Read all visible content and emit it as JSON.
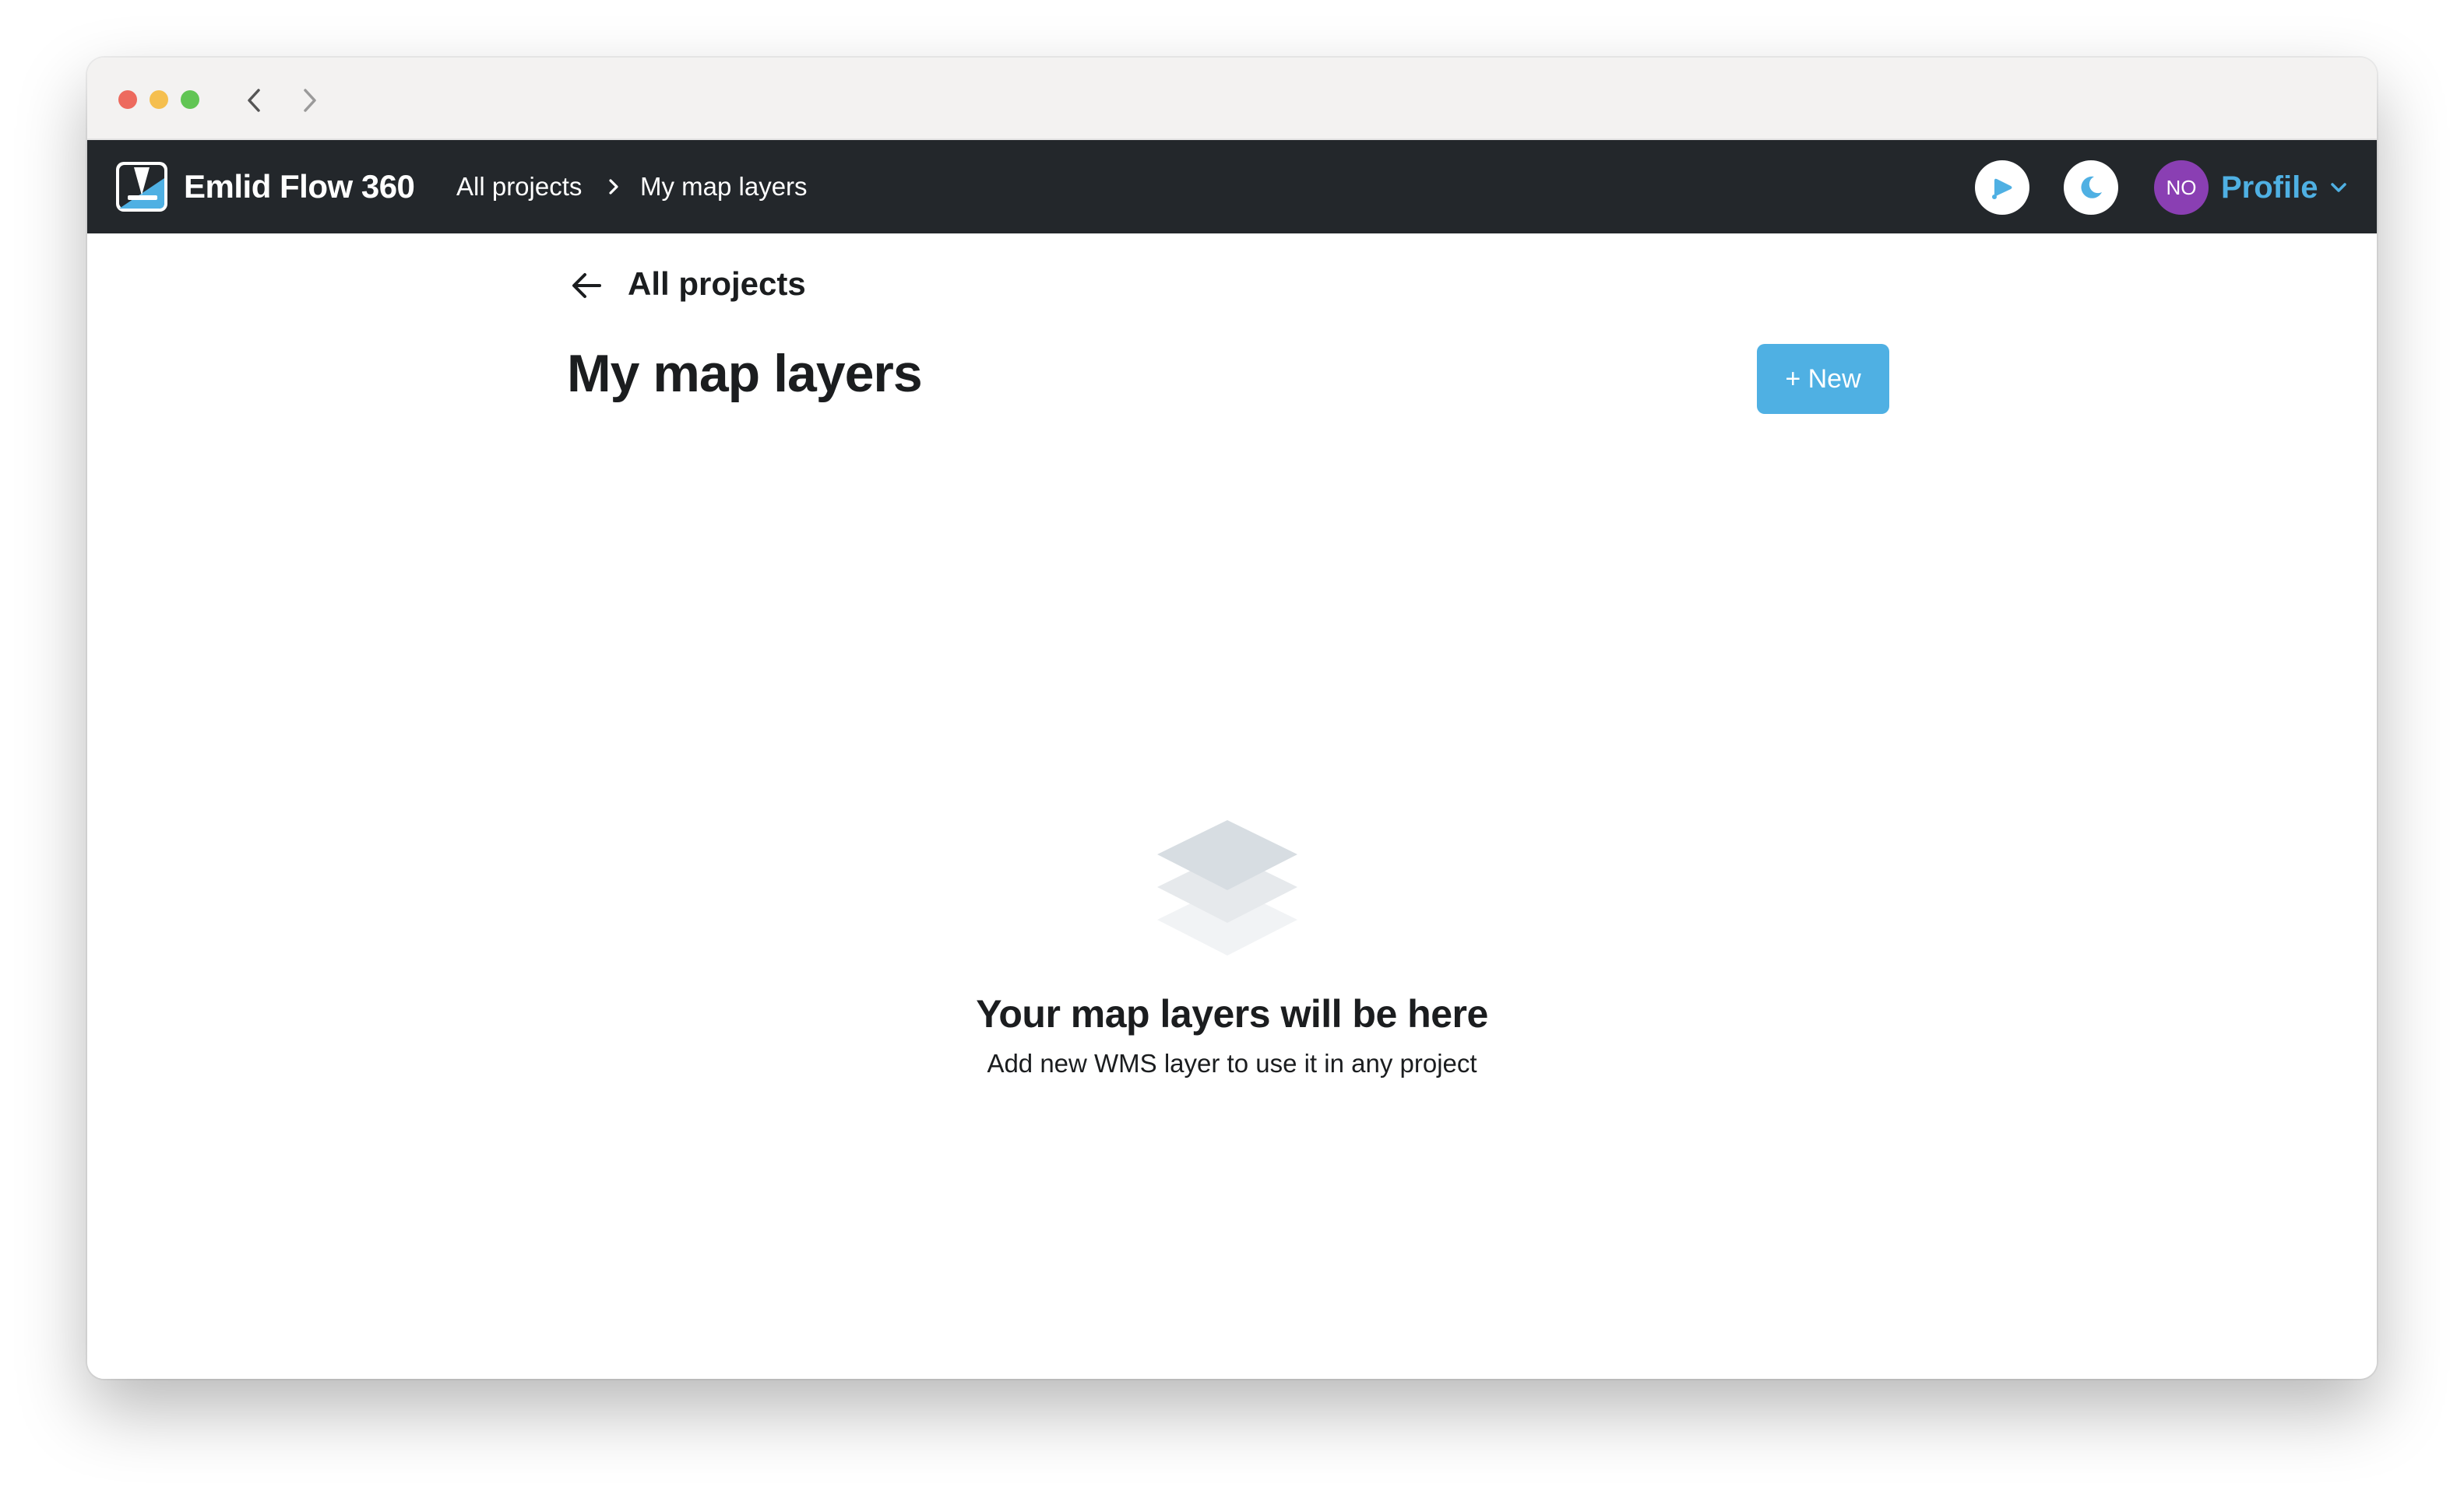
{
  "app": {
    "name": "Emlid Flow 360"
  },
  "breadcrumb": {
    "items": [
      {
        "label": "All projects"
      },
      {
        "label": "My map layers"
      }
    ]
  },
  "header": {
    "avatar_initials": "NO",
    "profile_label": "Profile",
    "icons": [
      "support-icon",
      "moon-icon",
      "chevron-down-icon"
    ]
  },
  "page": {
    "back_label": "All projects",
    "title": "My map layers",
    "new_button_label": "+ New"
  },
  "empty_state": {
    "title": "Your map layers will be here",
    "subtitle": "Add new WMS layer to use it in any project",
    "icon": "layers-icon"
  },
  "colors": {
    "appbar": "#23272b",
    "accent": "#4fb0e3",
    "avatar": "#8a3fb3"
  }
}
